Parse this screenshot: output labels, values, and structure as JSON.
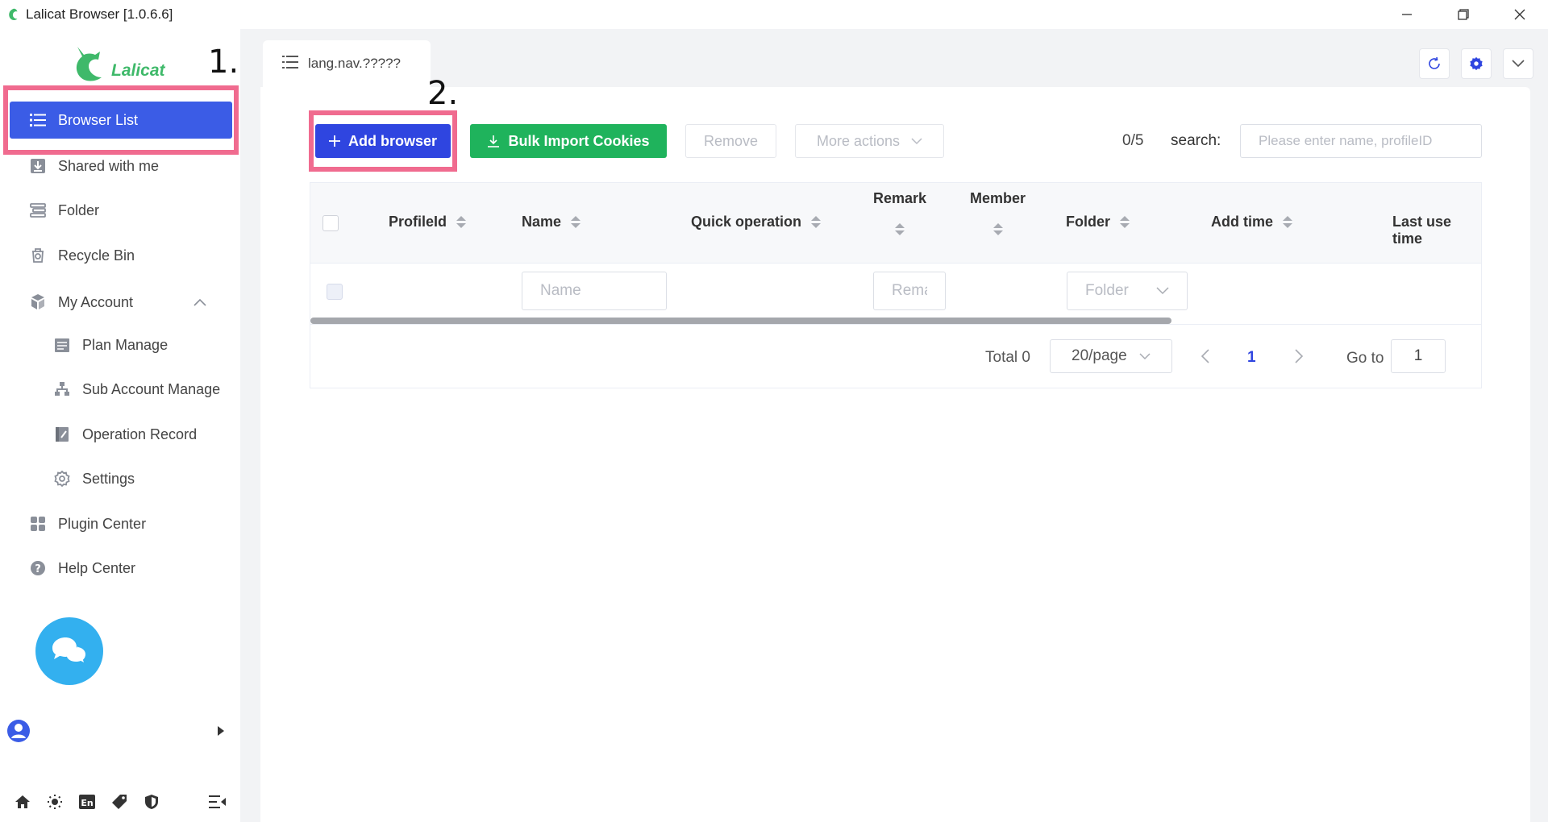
{
  "titlebar": {
    "title": "Lalicat Browser  [1.0.6.6]",
    "minimize_icon": "minimize-icon",
    "restore_icon": "restore-icon",
    "close_icon": "close-icon"
  },
  "brand": {
    "text": "Lalicat"
  },
  "annotations": {
    "step1": "1.",
    "step2": "2.",
    "highlight_color": "#f06b8f"
  },
  "sidebar": {
    "items": [
      {
        "label": "Browser List",
        "icon": "list-icon"
      },
      {
        "label": "Shared with me",
        "icon": "download-icon"
      },
      {
        "label": "Folder",
        "icon": "folder-icon"
      },
      {
        "label": "Recycle Bin",
        "icon": "trash-icon"
      },
      {
        "label": "My Account",
        "icon": "account-icon"
      },
      {
        "label": "Plan Manage",
        "icon": "plan-icon"
      },
      {
        "label": "Sub Account Manage",
        "icon": "org-icon"
      },
      {
        "label": "Operation Record",
        "icon": "record-icon"
      },
      {
        "label": "Settings",
        "icon": "gear-icon"
      },
      {
        "label": "Plugin Center",
        "icon": "grid-icon"
      },
      {
        "label": "Help Center",
        "icon": "help-icon"
      }
    ]
  },
  "tab": {
    "label": "lang.nav.?????"
  },
  "toolbar": {
    "add_browser": "Add browser",
    "bulk_import": "Bulk Import Cookies",
    "remove": "Remove",
    "more_actions": "More actions",
    "count": "0/5",
    "search_label": "search:",
    "search_placeholder": "Please enter name, profileID"
  },
  "table": {
    "columns": {
      "profile_id": "ProfileId",
      "name": "Name",
      "quick_operation": "Quick operation",
      "remark": "Remark",
      "member": "Member",
      "folder": "Folder",
      "add_time": "Add time",
      "last_use_time": "Last use time"
    },
    "filters": {
      "name_placeholder": "Name",
      "remark_placeholder": "Rema",
      "folder_placeholder": "Folder"
    }
  },
  "pagination": {
    "total": "Total 0",
    "page_size": "20/page",
    "current_page": "1",
    "goto_label": "Go to",
    "goto_value": "1"
  },
  "colors": {
    "primary": "#2f45e0",
    "sidebar_active": "#3b5ce6",
    "success": "#1fb35c",
    "chat": "#33b0ef"
  }
}
